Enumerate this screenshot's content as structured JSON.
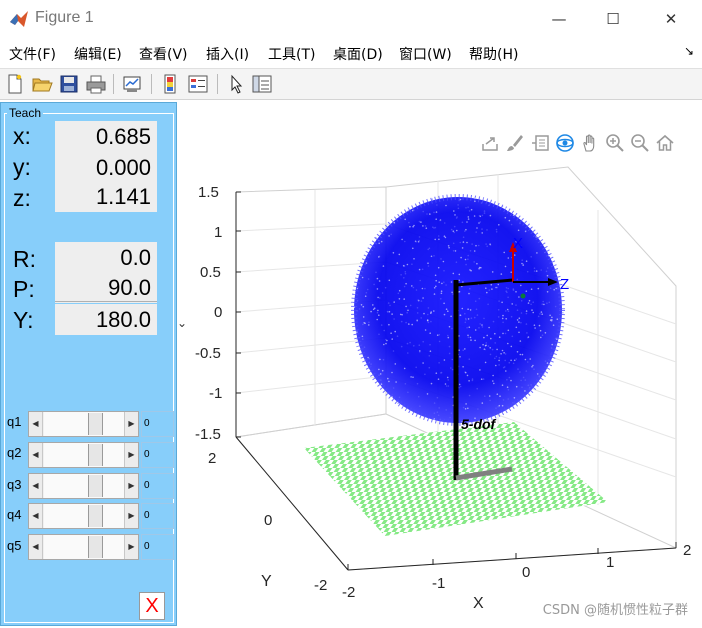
{
  "window": {
    "title": "Figure 1",
    "controls": {
      "minimize": "—",
      "maximize": "☐",
      "close": "✕"
    }
  },
  "menu": {
    "items": [
      "文件(F)",
      "编辑(E)",
      "查看(V)",
      "插入(I)",
      "工具(T)",
      "桌面(D)",
      "窗口(W)",
      "帮助(H)"
    ],
    "corner_glyph": "↘"
  },
  "toolbar": {
    "icons": [
      "new-figure-icon",
      "open-file-icon",
      "save-icon",
      "print-icon",
      "link-plot-icon",
      "insert-colorbar-icon",
      "insert-legend-icon",
      "edit-plot-icon",
      "property-inspector-icon"
    ]
  },
  "teach": {
    "title": "Teach",
    "pose": [
      {
        "label": "x:",
        "value": "0.685"
      },
      {
        "label": "y:",
        "value": "0.000"
      },
      {
        "label": "z:",
        "value": "1.141"
      },
      {
        "label": "R:",
        "value": "0.0"
      },
      {
        "label": "P:",
        "value": "90.0"
      },
      {
        "label": "Y:",
        "value": "180.0"
      }
    ],
    "joints": [
      {
        "label": "q1",
        "value": "0"
      },
      {
        "label": "q2",
        "value": "0"
      },
      {
        "label": "q3",
        "value": "0"
      },
      {
        "label": "q4",
        "value": "0"
      },
      {
        "label": "q5",
        "value": "0"
      }
    ],
    "close_label": "X",
    "stray_mark": "⌄"
  },
  "axes_toolbar": {
    "icons": [
      "export-icon",
      "brush-icon",
      "datatip-icon",
      "rotate-3d-icon",
      "pan-hand-icon",
      "zoom-in-icon",
      "zoom-out-icon",
      "home-icon"
    ]
  },
  "plot": {
    "z_ticks": [
      "1.5",
      "1",
      "0.5",
      "0",
      "-0.5",
      "-1",
      "-1.5"
    ],
    "y_ticks": [
      "2",
      "0",
      "-2"
    ],
    "x_ticks": [
      "-2",
      "-1",
      "0",
      "1",
      "2"
    ],
    "x_label": "X",
    "y_label": "Y",
    "robot_name": "5-dof",
    "frame_labels": {
      "x": "X",
      "z": "Z"
    },
    "colors": {
      "workspace": "#0000ff",
      "floor": "#86e986",
      "robot": "#000000"
    }
  },
  "watermark": "CSDN @随机惯性粒子群"
}
